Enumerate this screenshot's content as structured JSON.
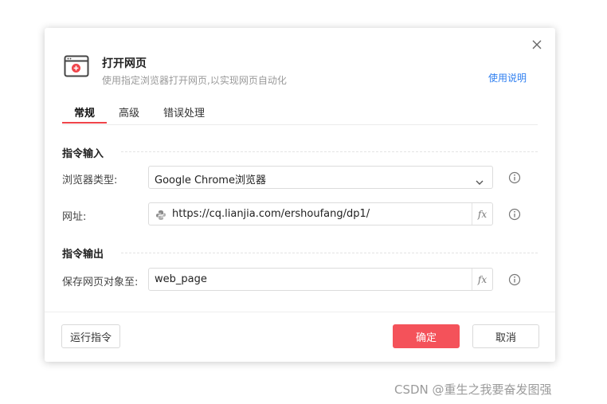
{
  "dialog": {
    "title": "打开网页",
    "subtitle": "使用指定浏览器打开网页,以实现网页自动化",
    "help_link": "使用说明",
    "icon": "browser-window-icon"
  },
  "tabs": [
    {
      "label": "常规",
      "active": true
    },
    {
      "label": "高级",
      "active": false
    },
    {
      "label": "错误处理",
      "active": false
    }
  ],
  "sections": {
    "input_title": "指令输入",
    "output_title": "指令输出"
  },
  "fields": {
    "browser_type": {
      "label": "浏览器类型:",
      "value": "Google Chrome浏览器"
    },
    "url": {
      "label": "网址:",
      "value": "https://cq.lianjia.com/ershoufang/dp1/",
      "fx": "fx"
    },
    "save_to": {
      "label": "保存网页对象至:",
      "value": "web_page",
      "fx": "fx"
    }
  },
  "buttons": {
    "run": "运行指令",
    "ok": "确定",
    "cancel": "取消"
  },
  "colors": {
    "accent": "#f4525a",
    "link": "#2f7ff0"
  },
  "watermark": "CSDN @重生之我要奋发图强"
}
